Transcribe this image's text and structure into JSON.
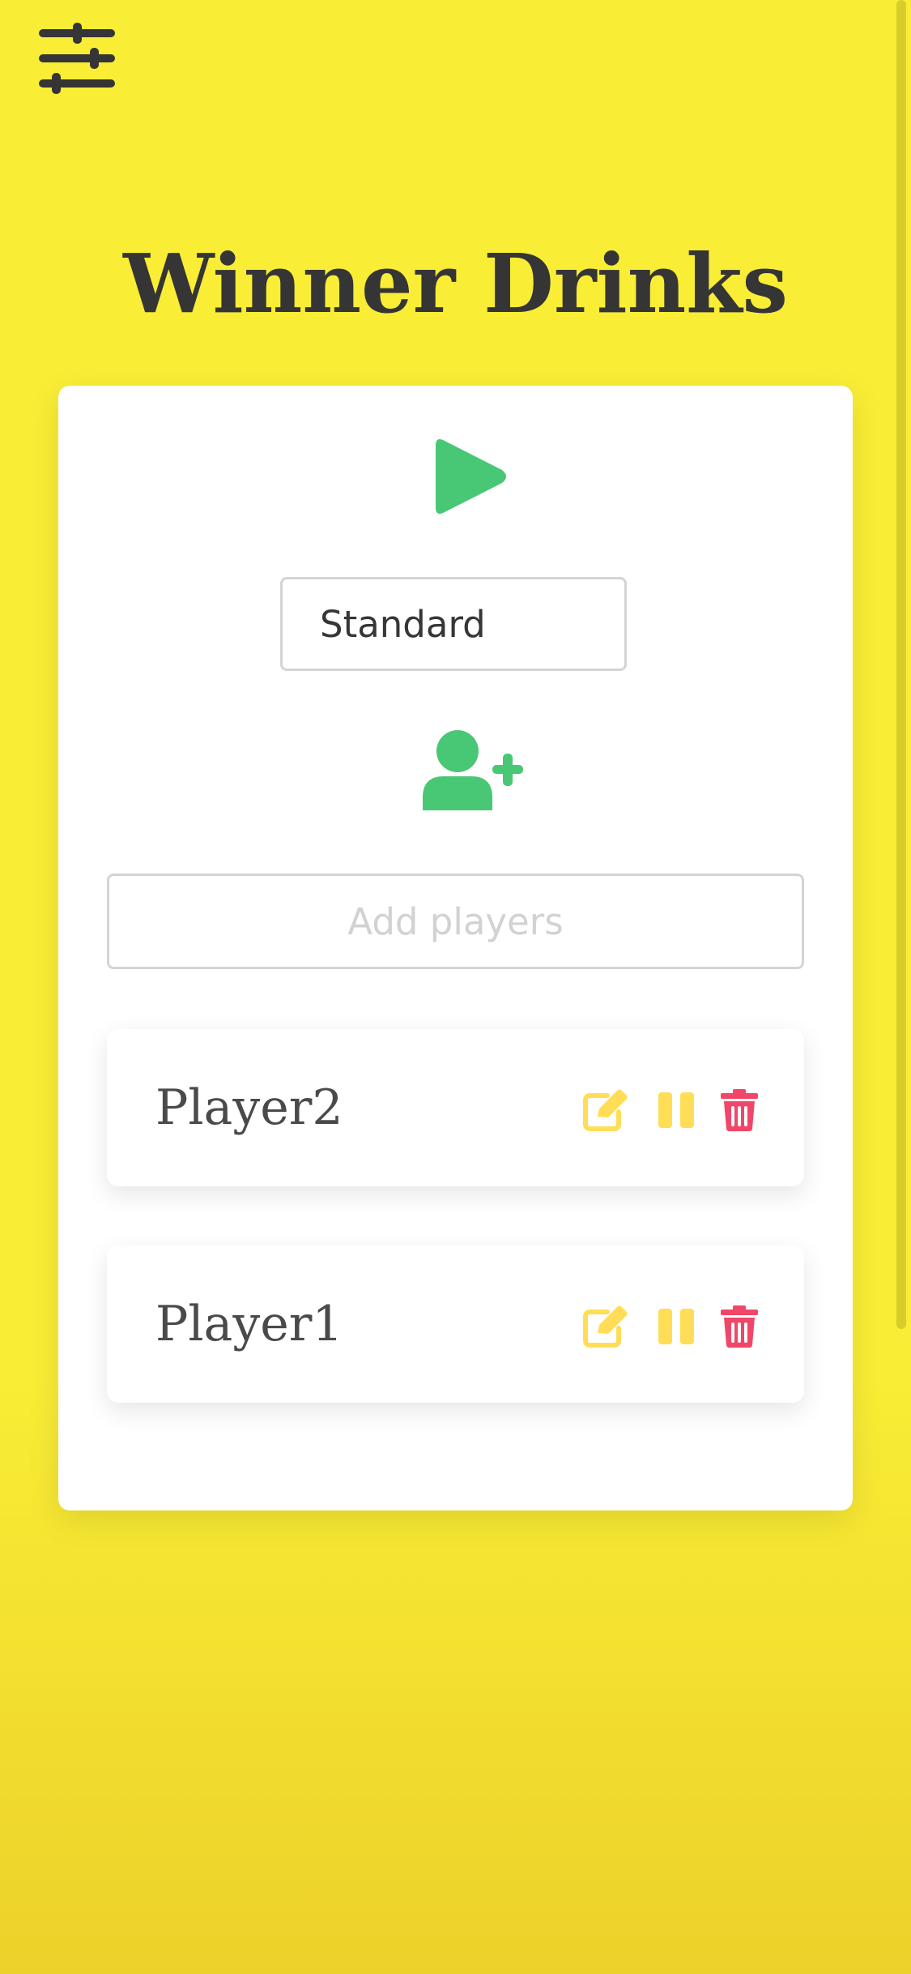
{
  "header": {
    "settings_icon": "sliders-icon",
    "title": "Winner Drinks"
  },
  "controls": {
    "play_icon": "play-icon",
    "mode_select": {
      "selected": "Standard"
    },
    "add_player_icon": "user-plus-icon",
    "add_players_input": {
      "value": "",
      "placeholder": "Add players"
    }
  },
  "players": [
    {
      "name": "Player2",
      "actions": [
        "edit-icon",
        "pause-icon",
        "trash-icon"
      ]
    },
    {
      "name": "Player1",
      "actions": [
        "edit-icon",
        "pause-icon",
        "trash-icon"
      ]
    }
  ],
  "colors": {
    "background": "#f9ed35",
    "text_dark": "#353535",
    "accent_green": "#48c774",
    "edit_pause_yellow": "#ffdd57",
    "delete_red": "#f14668"
  }
}
